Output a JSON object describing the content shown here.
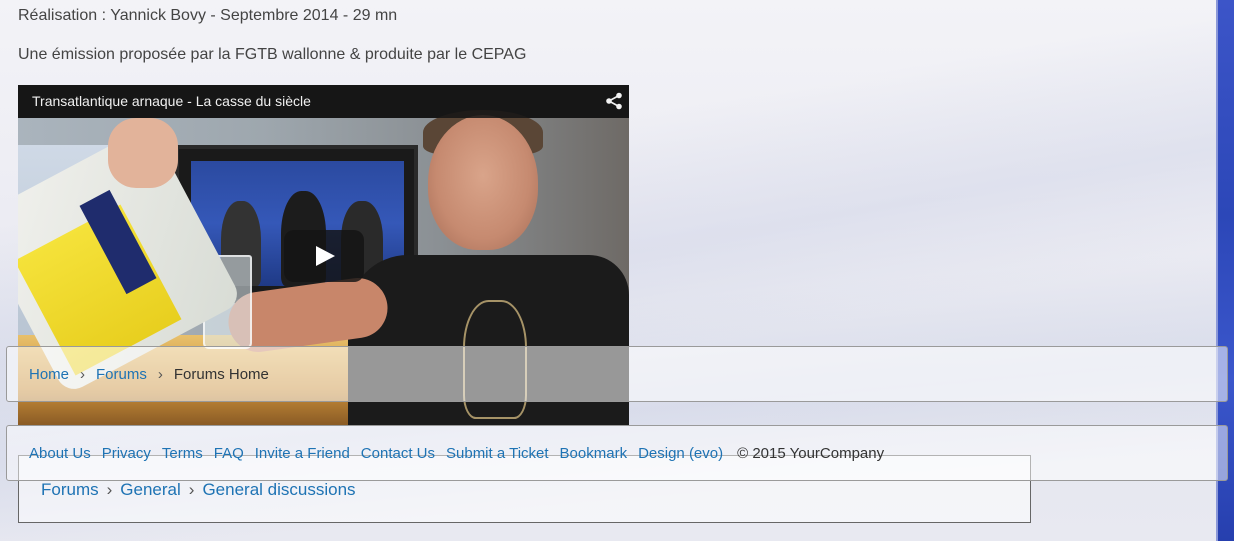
{
  "article": {
    "credit": "Réalisation : Yannick Bovy - Septembre 2014 - 29 mn",
    "producer": "Une émission proposée par la FGTB wallonne & produite par le CEPAG"
  },
  "video": {
    "title": "Transatlantique arnaque - La casse du siècle",
    "icons": {
      "share": "share-icon",
      "play": "play-icon"
    }
  },
  "breadcrumb": {
    "items": [
      "Home",
      "Forums"
    ],
    "current": "Forums Home",
    "separator": "›"
  },
  "footer": {
    "links": [
      "About Us",
      "Privacy",
      "Terms",
      "FAQ",
      "Invite a Friend",
      "Contact Us",
      "Submit a Ticket",
      "Bookmark",
      "Design (evo)"
    ],
    "copyright": "© 2015 YourCompany"
  },
  "forum_path": {
    "items": [
      "Forums",
      "General",
      "General discussions"
    ],
    "separator": "›"
  },
  "colors": {
    "link": "#1e73b4",
    "text": "#333333",
    "right_strip": "#2c47b8"
  }
}
